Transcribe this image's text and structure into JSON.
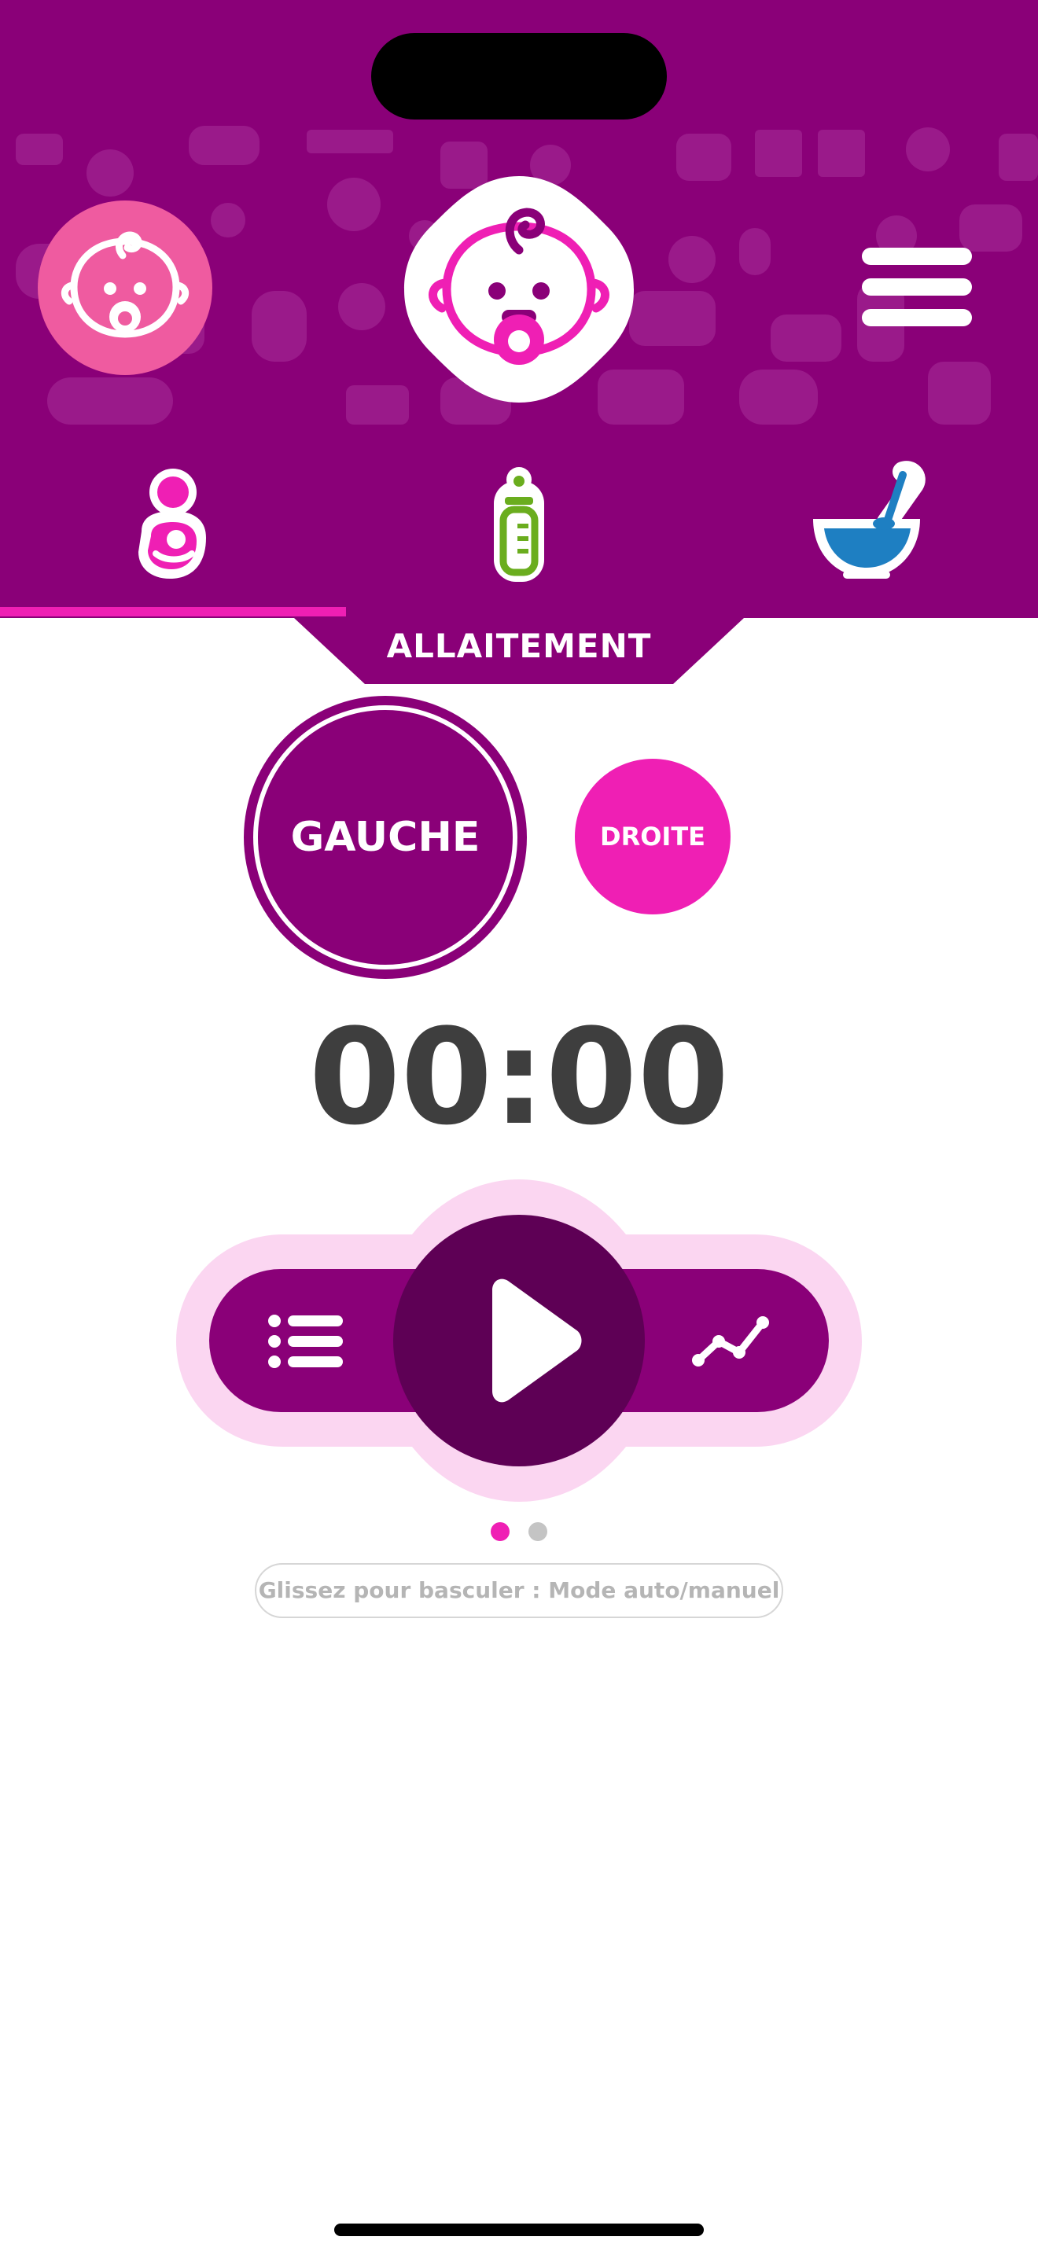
{
  "header": {
    "pattern_icons": [
      "stroller",
      "bib",
      "pacifier",
      "bottle",
      "onesie",
      "teddy",
      "rattle",
      "footprints",
      "mobile",
      "apple",
      "pot"
    ]
  },
  "tabs": [
    {
      "icon": "breastfeeding-icon",
      "active": true
    },
    {
      "icon": "baby-bottle-icon",
      "active": false
    },
    {
      "icon": "food-bowl-icon",
      "active": false
    }
  ],
  "section": {
    "title": "ALLAITEMENT"
  },
  "sides": {
    "left_label": "GAUCHE",
    "right_label": "DROITE",
    "selected": "GAUCHE"
  },
  "timer": {
    "value": "00:00"
  },
  "controls": {
    "left_icon": "list-icon",
    "center_icon": "play-icon",
    "right_icon": "chart-line-icon"
  },
  "pager": {
    "pages": 2,
    "current": 1
  },
  "hint": {
    "text": "Glissez pour basculer : Mode auto/manuel"
  },
  "colors": {
    "primary": "#8a0078",
    "accent": "#ef1fb4",
    "pink": "#ef5ba0",
    "dark_purple": "#5e0055",
    "light_pink": "#fbd6f1",
    "timer": "#3e3e3e",
    "bottle_green": "#6aad1e",
    "bowl_blue": "#1e7fc2"
  }
}
